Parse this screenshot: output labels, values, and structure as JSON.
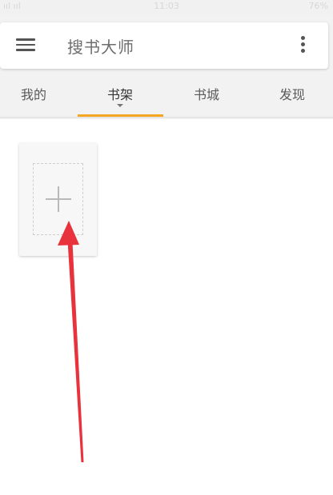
{
  "status_bar": {
    "carrier": "ııl ııl",
    "time": "11:03",
    "battery": "76%"
  },
  "header": {
    "title": "搜书大师"
  },
  "tabs": [
    {
      "label": "我的"
    },
    {
      "label": "书架"
    },
    {
      "label": "书城"
    },
    {
      "label": "发现"
    }
  ],
  "active_tab": "书架",
  "colors": {
    "accent": "#f5a623",
    "annotation_arrow": "#e8323c"
  },
  "icons": [
    "menu-icon",
    "more-vert-icon",
    "plus-icon"
  ]
}
